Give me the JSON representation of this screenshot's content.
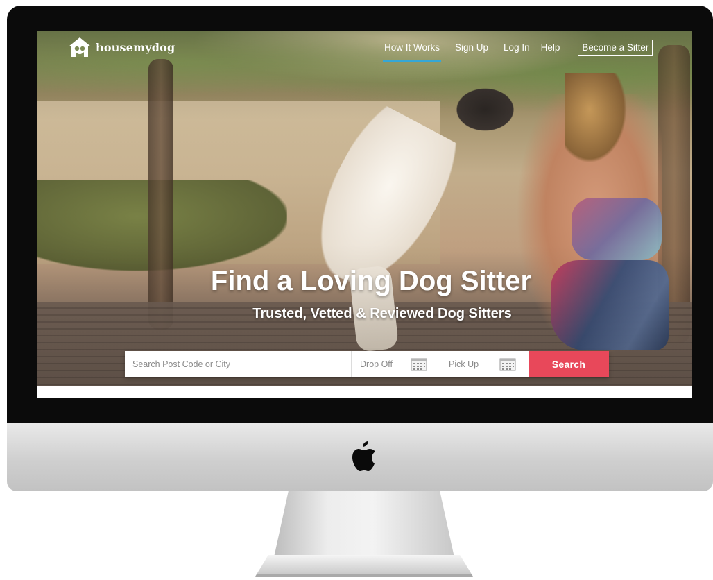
{
  "brand": {
    "name": "housemydog"
  },
  "nav": {
    "links": [
      "How It Works",
      "Sign Up",
      "Log In",
      "Help"
    ],
    "active": "How It Works",
    "cta": "Become a Sitter"
  },
  "hero": {
    "title": "Find a Loving Dog Sitter",
    "subtitle": "Trusted, Vetted & Reviewed Dog Sitters"
  },
  "search": {
    "placeholder": "Search Post Code or City",
    "dropoff_label": "Drop Off",
    "pickup_label": "Pick Up",
    "button_label": "Search"
  },
  "colors": {
    "accent_active_underline": "#35a7d6",
    "search_button": "#e8485a"
  },
  "icons": {
    "logo": "house-dog-logo-icon",
    "calendar": "calendar-icon",
    "device_brand": "apple-logo-icon"
  }
}
